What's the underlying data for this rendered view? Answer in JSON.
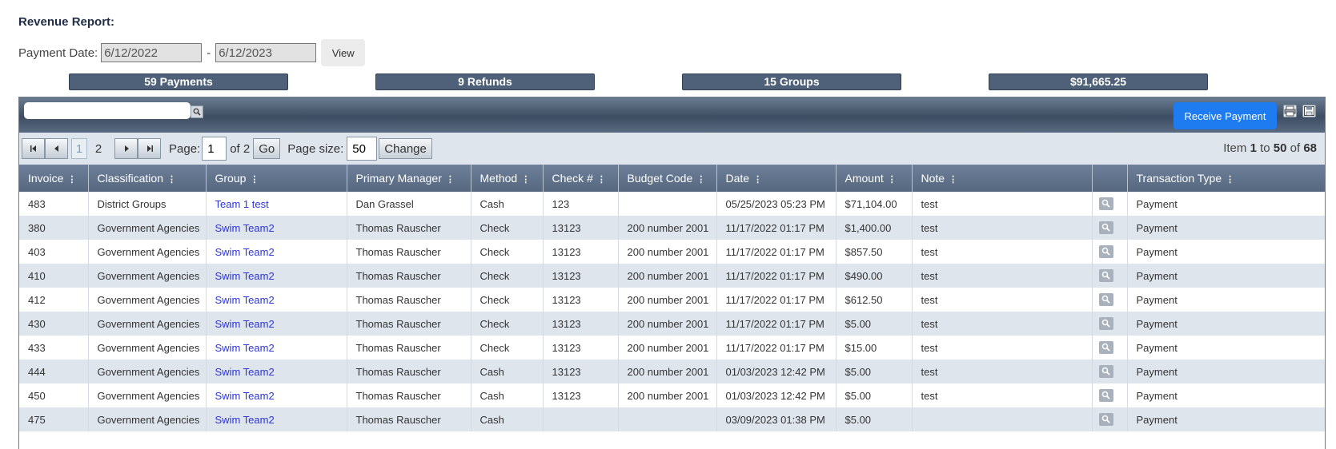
{
  "report": {
    "title": "Revenue Report:",
    "payment_date_label": "Payment Date:",
    "date_from": "6/12/2022",
    "date_sep": "-",
    "date_to": "6/12/2023",
    "view_label": "View"
  },
  "stats": [
    "59 Payments",
    "9 Refunds",
    "15 Groups",
    "$91,665.25"
  ],
  "toolbar": {
    "search_value": "",
    "receive_label": "Receive Payment",
    "icons": [
      "search-icon",
      "print-icon",
      "save-icon"
    ]
  },
  "pager": {
    "pages": [
      "1",
      "2"
    ],
    "page_label": "Page:",
    "page_value": "1",
    "of_label": "of 2",
    "go_label": "Go",
    "size_label": "Page size:",
    "size_value": "50",
    "change_label": "Change",
    "item_prefix": "Item",
    "item_from": "1",
    "item_to_word": "to",
    "item_to": "50",
    "item_of_word": "of",
    "item_total": "68"
  },
  "columns": [
    "Invoice",
    "Classification",
    "Group",
    "Primary Manager",
    "Method",
    "Check #",
    "Budget Code",
    "Date",
    "Amount",
    "Note",
    "",
    "Transaction Type"
  ],
  "rows": [
    [
      "483",
      "District Groups",
      "Team 1 test",
      "Dan Grassel",
      "Cash",
      "123",
      "",
      "05/25/2023 05:23 PM",
      "$71,104.00",
      "test",
      "Payment"
    ],
    [
      "380",
      "Government Agencies",
      "Swim Team2",
      "Thomas Rauscher",
      "Check",
      "13123",
      "200 number 2001",
      "11/17/2022 01:17 PM",
      "$1,400.00",
      "test",
      "Payment"
    ],
    [
      "403",
      "Government Agencies",
      "Swim Team2",
      "Thomas Rauscher",
      "Check",
      "13123",
      "200 number 2001",
      "11/17/2022 01:17 PM",
      "$857.50",
      "test",
      "Payment"
    ],
    [
      "410",
      "Government Agencies",
      "Swim Team2",
      "Thomas Rauscher",
      "Check",
      "13123",
      "200 number 2001",
      "11/17/2022 01:17 PM",
      "$490.00",
      "test",
      "Payment"
    ],
    [
      "412",
      "Government Agencies",
      "Swim Team2",
      "Thomas Rauscher",
      "Check",
      "13123",
      "200 number 2001",
      "11/17/2022 01:17 PM",
      "$612.50",
      "test",
      "Payment"
    ],
    [
      "430",
      "Government Agencies",
      "Swim Team2",
      "Thomas Rauscher",
      "Check",
      "13123",
      "200 number 2001",
      "11/17/2022 01:17 PM",
      "$5.00",
      "test",
      "Payment"
    ],
    [
      "433",
      "Government Agencies",
      "Swim Team2",
      "Thomas Rauscher",
      "Check",
      "13123",
      "200 number 2001",
      "11/17/2022 01:17 PM",
      "$15.00",
      "test",
      "Payment"
    ],
    [
      "444",
      "Government Agencies",
      "Swim Team2",
      "Thomas Rauscher",
      "Cash",
      "13123",
      "200 number 2001",
      "01/03/2023 12:42 PM",
      "$5.00",
      "test",
      "Payment"
    ],
    [
      "450",
      "Government Agencies",
      "Swim Team2",
      "Thomas Rauscher",
      "Cash",
      "13123",
      "200 number 2001",
      "01/03/2023 12:42 PM",
      "$5.00",
      "test",
      "Payment"
    ],
    [
      "475",
      "Government Agencies",
      "Swim Team2",
      "Thomas Rauscher",
      "Cash",
      "",
      "",
      "03/09/2023 01:38 PM",
      "$5.00",
      "",
      "Payment"
    ]
  ],
  "colors": {
    "accent": "#1e7bf0",
    "header": "#56677f",
    "link": "#2c35d6",
    "stripe": "#dfe5ec"
  }
}
